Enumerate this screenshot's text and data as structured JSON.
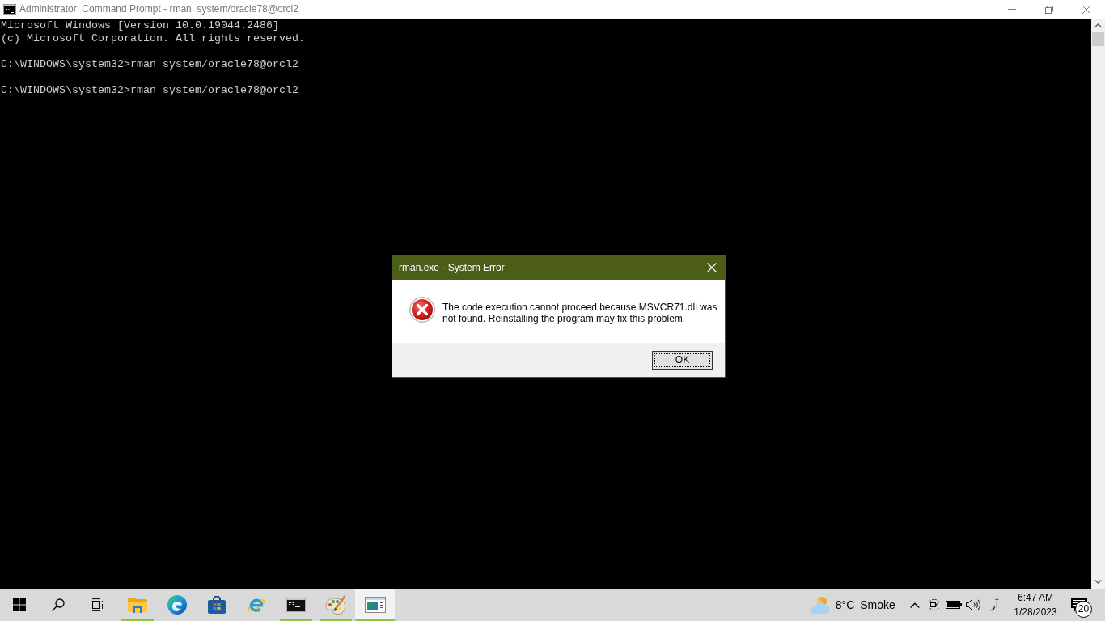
{
  "window": {
    "title": "Administrator: Command Prompt - rman  system/oracle78@orcl2"
  },
  "console": {
    "blocks": [
      [
        "Microsoft Windows [Version 10.0.19044.2486]",
        "(c) Microsoft Corporation. All rights reserved."
      ],
      [
        "C:\\WINDOWS\\system32>rman system/oracle78@orcl2"
      ],
      [
        "C:\\WINDOWS\\system32>rman system/oracle78@orcl2"
      ]
    ]
  },
  "dialog": {
    "title": "rman.exe - System Error",
    "message": "The code execution cannot proceed because MSVCR71.dll was not found. Reinstalling the program may fix this problem.",
    "buttons": [
      {
        "label": "OK",
        "focused": true
      }
    ]
  },
  "taskbar": {
    "pinned": [
      {
        "running": true,
        "selected": false
      },
      {
        "running": false,
        "selected": false
      },
      {
        "running": false,
        "selected": false
      },
      {
        "running": false,
        "selected": false
      },
      {
        "running": true,
        "selected": false
      },
      {
        "running": true,
        "selected": false
      },
      {
        "running": true,
        "selected": true
      }
    ],
    "weather": {
      "temperature": "8°C",
      "condition": "Smoke"
    },
    "input_language": "آر",
    "clock": {
      "time": "6:47 AM",
      "date": "1/28/2023"
    },
    "notifications": {
      "count": "20"
    }
  }
}
